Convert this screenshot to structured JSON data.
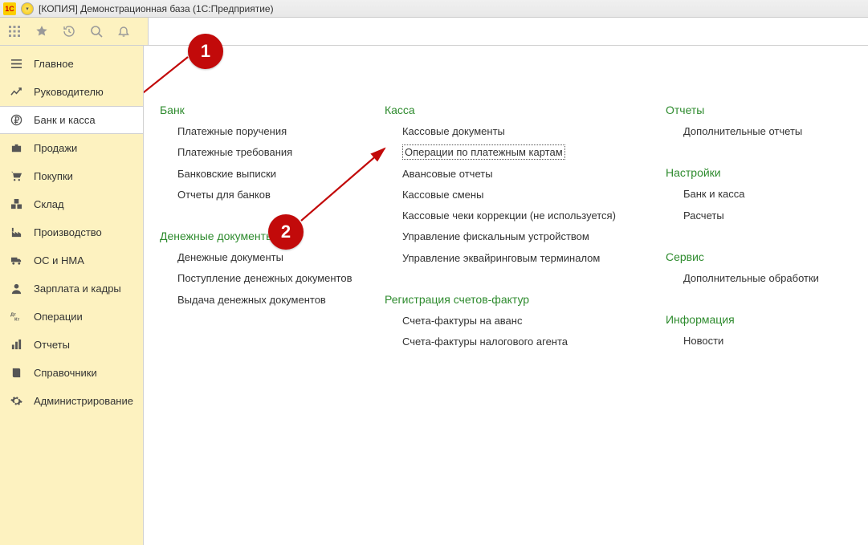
{
  "titlebar": {
    "app_logo_text": "1C",
    "title": "[КОПИЯ] Демонстрационная база  (1С:Предприятие)"
  },
  "sidebar": {
    "items": [
      {
        "label": "Главное"
      },
      {
        "label": "Руководителю"
      },
      {
        "label": "Банк и касса"
      },
      {
        "label": "Продажи"
      },
      {
        "label": "Покупки"
      },
      {
        "label": "Склад"
      },
      {
        "label": "Производство"
      },
      {
        "label": "ОС и НМА"
      },
      {
        "label": "Зарплата и кадры"
      },
      {
        "label": "Операции"
      },
      {
        "label": "Отчеты"
      },
      {
        "label": "Справочники"
      },
      {
        "label": "Администрирование"
      }
    ],
    "active_index": 2
  },
  "content": {
    "col1": {
      "section1": {
        "title": "Банк",
        "links": [
          "Платежные поручения",
          "Платежные требования",
          "Банковские выписки",
          "Отчеты для банков"
        ]
      },
      "section2": {
        "title": "Денежные документы",
        "links": [
          "Денежные документы",
          "Поступление денежных документов",
          "Выдача денежных документов"
        ]
      }
    },
    "col2": {
      "section1": {
        "title": "Касса",
        "links": [
          "Кассовые документы",
          "Операции по платежным картам",
          "Авансовые отчеты",
          "Кассовые смены",
          "Кассовые чеки коррекции (не используется)",
          "Управление фискальным устройством",
          "Управление эквайринговым терминалом"
        ]
      },
      "section2": {
        "title": "Регистрация счетов-фактур",
        "links": [
          "Счета-фактуры на аванс",
          "Счета-фактуры налогового агента"
        ]
      }
    },
    "col3": {
      "section1": {
        "title": "Отчеты",
        "links": [
          "Дополнительные отчеты"
        ]
      },
      "section2": {
        "title": "Настройки",
        "links": [
          "Банк и касса",
          "Расчеты"
        ]
      },
      "section3": {
        "title": "Сервис",
        "links": [
          "Дополнительные обработки"
        ]
      },
      "section4": {
        "title": "Информация",
        "links": [
          "Новости"
        ]
      }
    }
  },
  "markers": {
    "m1": "1",
    "m2": "2"
  }
}
